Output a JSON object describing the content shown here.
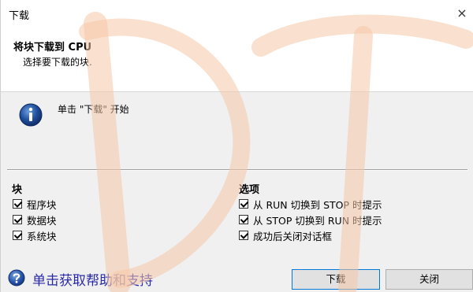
{
  "window": {
    "title": "下载",
    "close_glyph": "×"
  },
  "header": {
    "title": "将块下载到 CPU",
    "subtitle": "选择要下载的块."
  },
  "info": {
    "message": "单击 \"下载\" 开始",
    "icon": "info-icon"
  },
  "blocks_group": {
    "title": "块",
    "items": [
      {
        "label": "程序块",
        "checked": true
      },
      {
        "label": "数据块",
        "checked": true
      },
      {
        "label": "系统块",
        "checked": true
      }
    ]
  },
  "options_group": {
    "title": "选项",
    "items": [
      {
        "label": "从 RUN 切换到 STOP 时提示",
        "checked": true
      },
      {
        "label": "从 STOP 切换到 RUN 时提示",
        "checked": true
      },
      {
        "label": "成功后关闭对话框",
        "checked": true
      }
    ]
  },
  "help": {
    "label": "单击获取帮助和支持",
    "icon": "help-icon"
  },
  "buttons": {
    "download": "下载",
    "close": "关闭"
  },
  "watermark": {
    "text": "DT",
    "color": "#f6c8a8"
  },
  "colors": {
    "help_link": "#2a2aa6",
    "info_icon": "#1f4e9c",
    "focus_border": "#0078d7"
  }
}
